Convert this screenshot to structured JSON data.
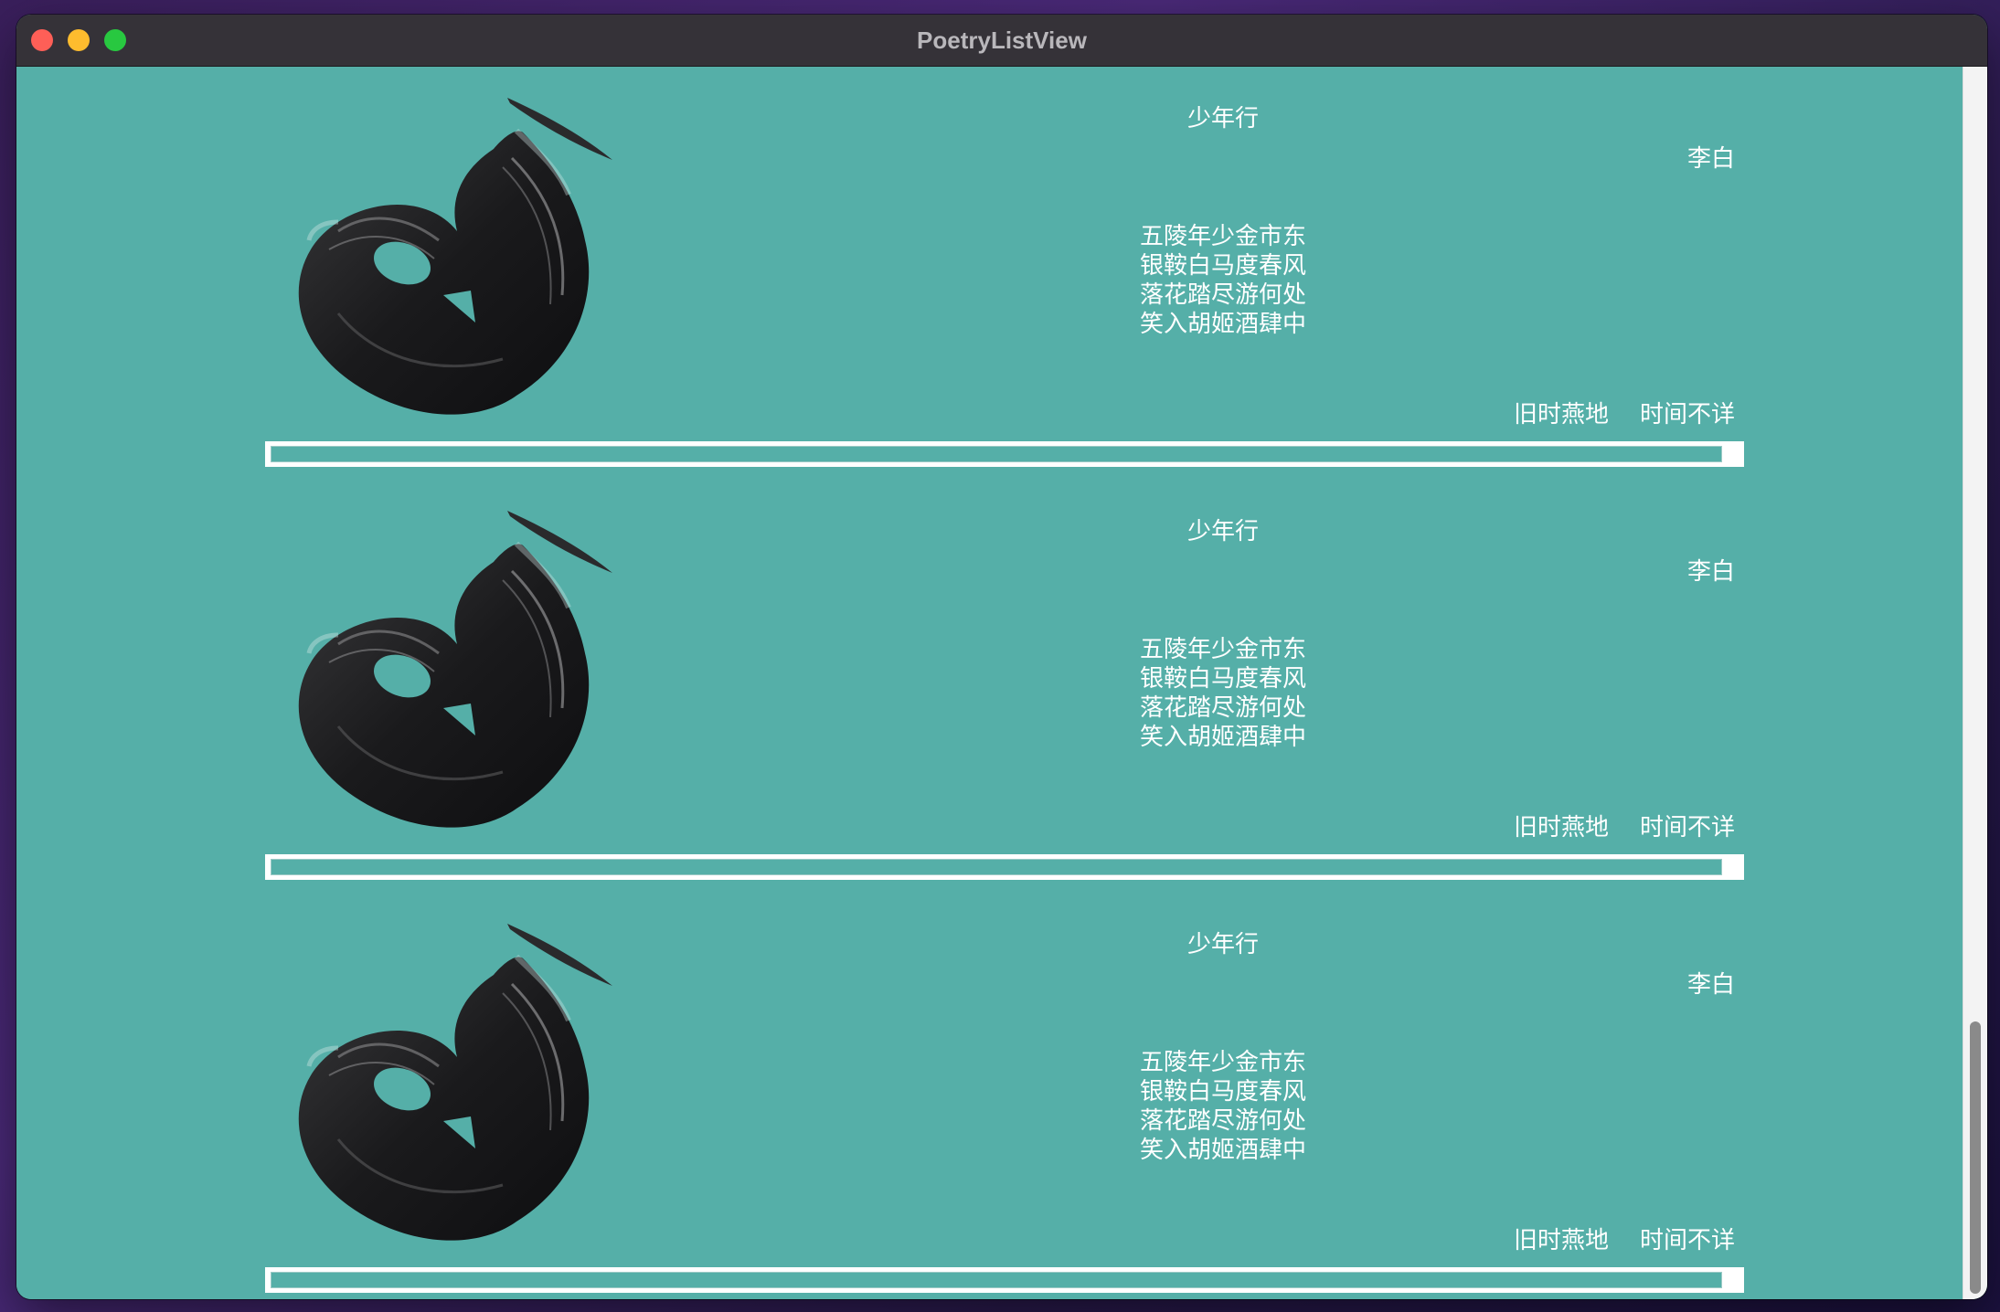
{
  "window": {
    "title": "PoetryListView"
  },
  "colors": {
    "background": "#55afa8",
    "text": "#ffffff",
    "titlebar": "#353238"
  },
  "icons": {
    "close": "close-button",
    "minimize": "minimize-button",
    "maximize": "zoom-button",
    "art": "ink-brush-illustration"
  },
  "poems": [
    {
      "title": "少年行",
      "author": "李白",
      "lines": [
        "五陵年少金市东",
        "银鞍白马度春风",
        "落花踏尽游何处",
        "笑入胡姬酒肆中"
      ],
      "place": "旧时燕地",
      "time": "时间不详"
    },
    {
      "title": "少年行",
      "author": "李白",
      "lines": [
        "五陵年少金市东",
        "银鞍白马度春风",
        "落花踏尽游何处",
        "笑入胡姬酒肆中"
      ],
      "place": "旧时燕地",
      "time": "时间不详"
    },
    {
      "title": "少年行",
      "author": "李白",
      "lines": [
        "五陵年少金市东",
        "银鞍白马度春风",
        "落花踏尽游何处",
        "笑入胡姬酒肆中"
      ],
      "place": "旧时燕地",
      "time": "时间不详"
    }
  ]
}
